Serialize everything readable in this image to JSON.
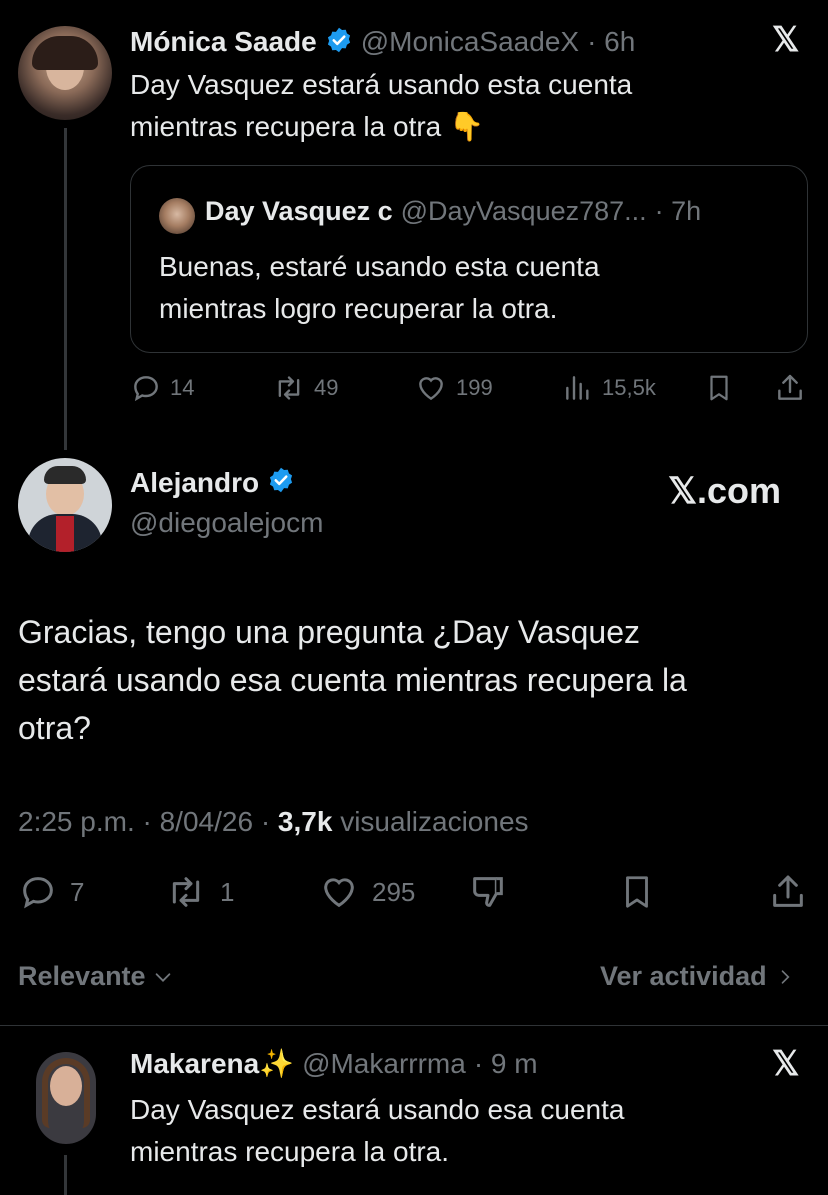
{
  "tweet1": {
    "name": "Mónica Saade",
    "handle": "@MonicaSaadeX",
    "time": "· 6h",
    "text_line1": "Day Vasquez estará usando esta cuenta",
    "text_line2": "mientras recupera la otra",
    "emoji": "👇",
    "quote": {
      "name": "Day Vasquez c",
      "handle": "@DayVasquez787...",
      "time": "· 7h",
      "text_line1": "Buenas, estaré usando esta cuenta",
      "text_line2": "mientras logro recuperar la otra."
    },
    "actions": {
      "replies": "14",
      "reposts": "49",
      "likes": "199",
      "views": "15,5k"
    }
  },
  "tweet2": {
    "name": "Alejandro",
    "handle": "@diegoalejocm",
    "watermark": "𝕏.com",
    "text_line1": "Gracias, tengo una pregunta ¿Day Vasquez",
    "text_line2": "estará usando esa cuenta mientras recupera la",
    "text_line3": "otra?",
    "meta_time": "2:25 p.m. · 8/04/26 ·",
    "meta_views_count": "3,7k",
    "meta_views_label": "visualizaciones",
    "actions": {
      "replies": "7",
      "reposts": "1",
      "likes": "295"
    }
  },
  "sort_bar": {
    "relevant_label": "Relevante",
    "activity_label": "Ver actividad"
  },
  "tweet3": {
    "name": "Makarena",
    "sparkle": "✨",
    "handle": "@Makarrrma",
    "time": "· 9 m",
    "text_line1": "Day Vasquez estará usando esa cuenta",
    "text_line2": "mientras recupera la otra."
  },
  "colors": {
    "background": "#000000",
    "text": "#e7e9ea",
    "muted": "#71767b",
    "verified": "#1d9bf0",
    "border": "#2f3336"
  }
}
